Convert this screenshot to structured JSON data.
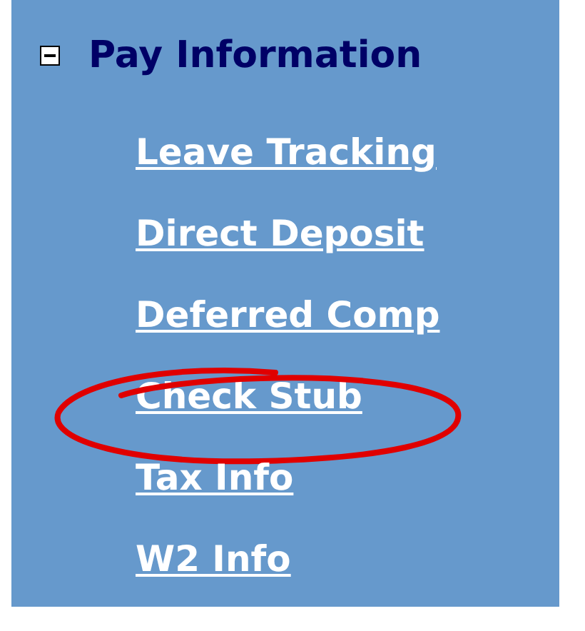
{
  "section": {
    "title": "Pay Information",
    "expanded": true,
    "links": [
      {
        "label": "Leave Tracking",
        "circled": false
      },
      {
        "label": "Direct Deposit",
        "circled": false
      },
      {
        "label": "Deferred Comp",
        "circled": false
      },
      {
        "label": "Check Stub",
        "circled": true
      },
      {
        "label": "Tax Info",
        "circled": false
      },
      {
        "label": "W2 Info",
        "circled": false
      }
    ]
  }
}
